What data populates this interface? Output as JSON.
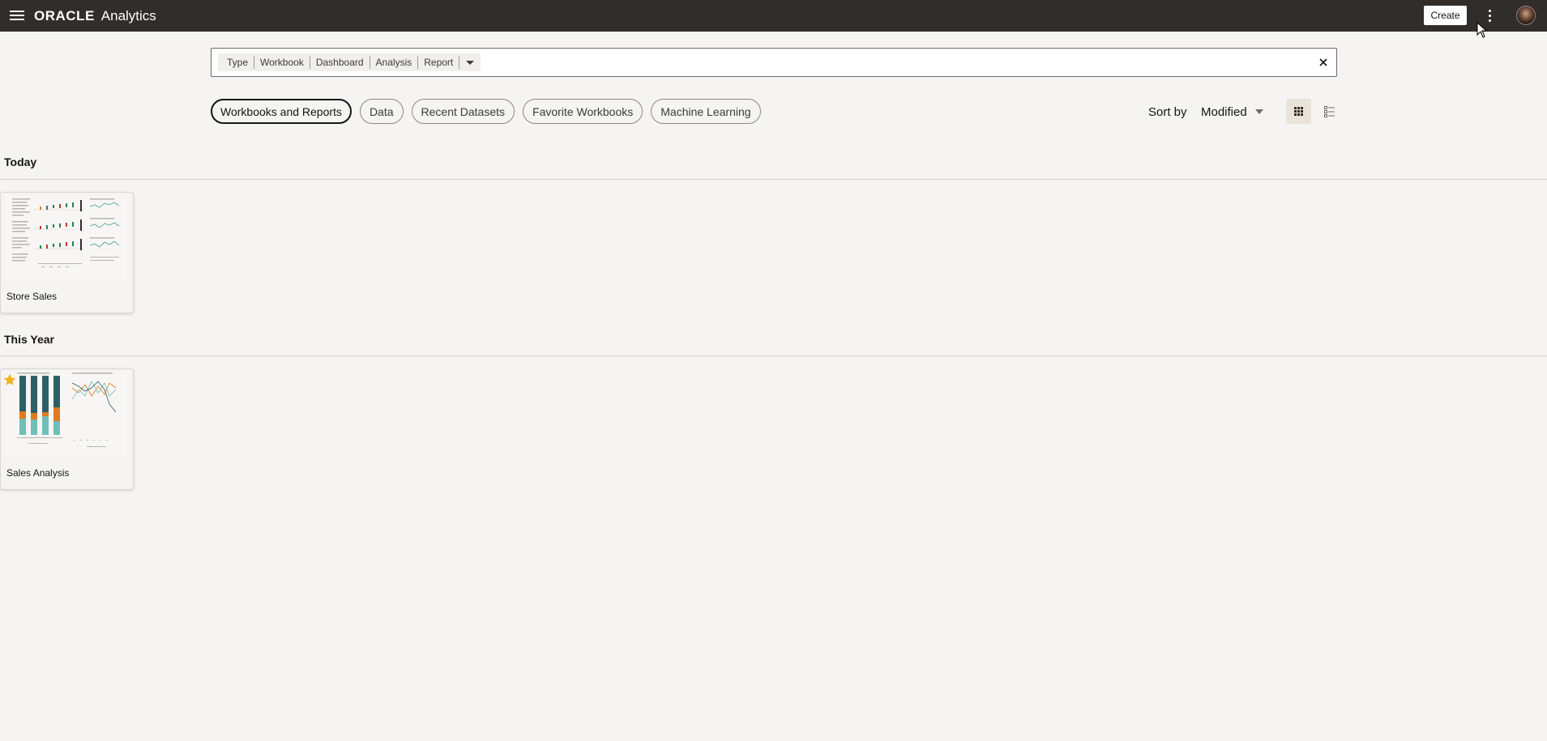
{
  "app": {
    "brand_logo": "ORACLE",
    "brand_product": "Analytics",
    "create_label": "Create"
  },
  "search": {
    "facets": [
      "Type",
      "Workbook",
      "Dashboard",
      "Analysis",
      "Report"
    ],
    "value": "",
    "placeholder": ""
  },
  "chips": [
    {
      "label": "Workbooks and Reports",
      "active": true
    },
    {
      "label": "Data",
      "active": false
    },
    {
      "label": "Recent Datasets",
      "active": false
    },
    {
      "label": "Favorite Workbooks",
      "active": false
    },
    {
      "label": "Machine Learning",
      "active": false
    }
  ],
  "sort": {
    "label": "Sort by",
    "value": "Modified"
  },
  "sections": [
    {
      "title": "Today",
      "items": [
        {
          "name": "Store Sales",
          "favorite": false
        }
      ]
    },
    {
      "title": "This Year",
      "items": [
        {
          "name": "Sales Analysis",
          "favorite": true
        }
      ]
    }
  ],
  "colors": {
    "topbar": "#312d2a",
    "background": "#f5f4f2",
    "teal_dark": "#2f5f66",
    "orange": "#e07a1f",
    "teal_light": "#6fbfb8",
    "star": "#f0b323"
  },
  "icons": {
    "menu": "hamburger-icon",
    "more": "kebab-icon",
    "clear": "close-icon",
    "grid_view": "grid-view-icon",
    "list_view": "list-view-icon",
    "favorite": "star-icon"
  }
}
